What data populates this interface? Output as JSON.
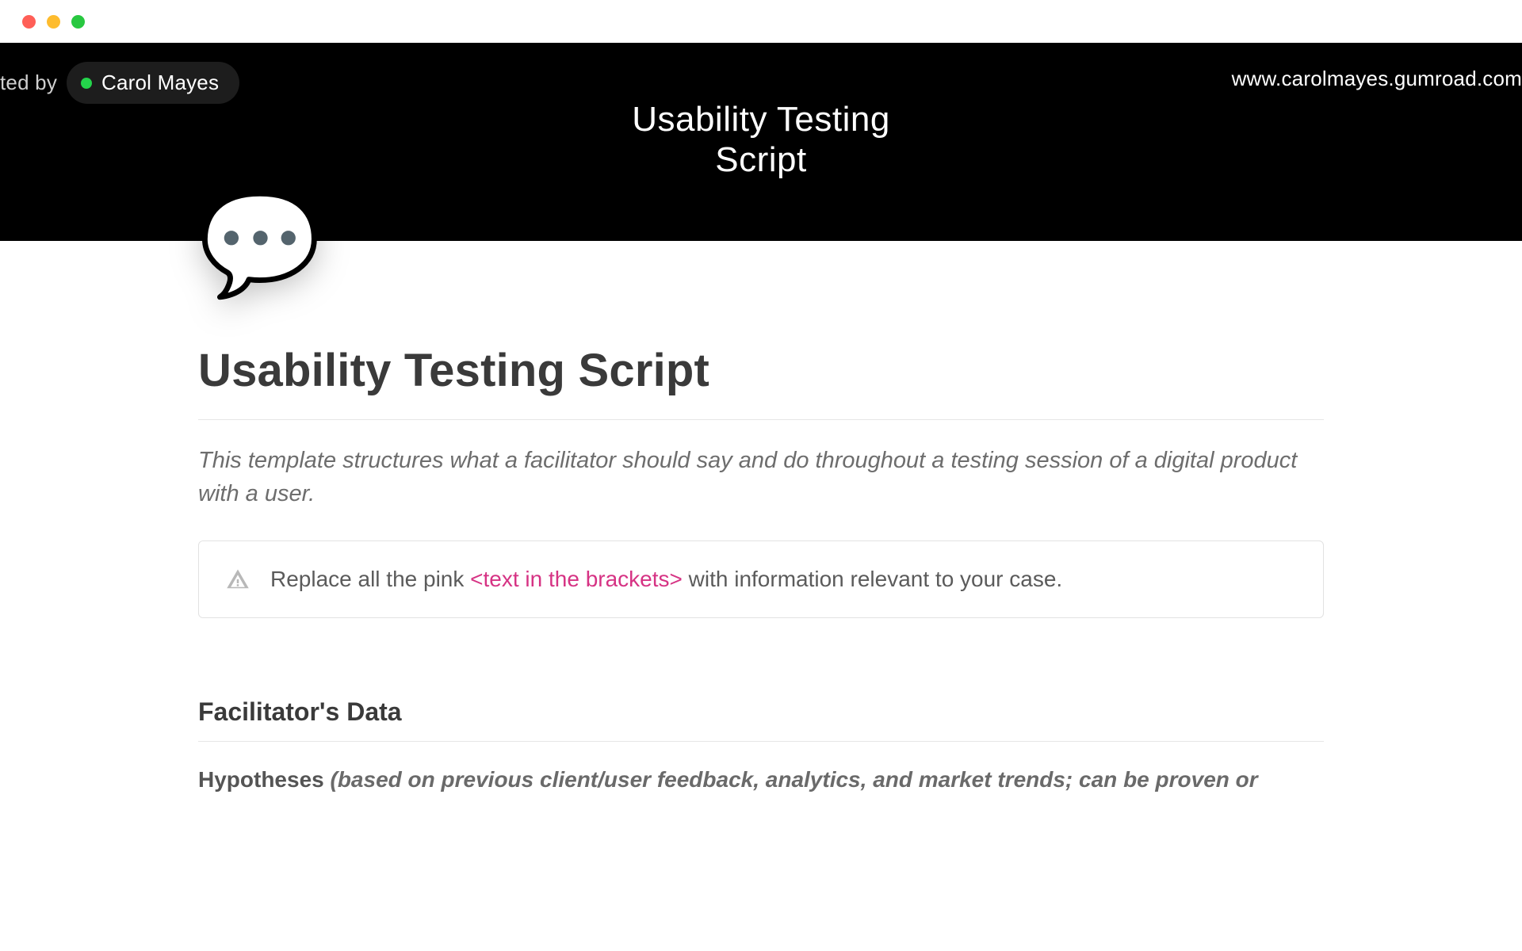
{
  "window": {
    "traffic_light_colors": [
      "#ff5f57",
      "#febc2e",
      "#28c840"
    ]
  },
  "cover": {
    "created_by_label": "ted by",
    "author_name": "Carol Mayes",
    "site_url": "www.carolmayes.gumroad.com",
    "title_line1": "Usability Testing",
    "title_line2": "Script",
    "page_icon": "💬"
  },
  "doc": {
    "title": "Usability Testing Script",
    "intro": "This template structures what a facilitator should say and do throughout a testing session of a digital product with a user.",
    "callout_prefix": "Replace all the pink ",
    "callout_pink": "<text in the brackets>",
    "callout_suffix": " with information relevant to your case.",
    "section1_heading": "Facilitator's Data",
    "hypotheses_label": "Hypotheses ",
    "hypotheses_note": "(based on previous client/user feedback, analytics, and market trends; can be proven or"
  }
}
